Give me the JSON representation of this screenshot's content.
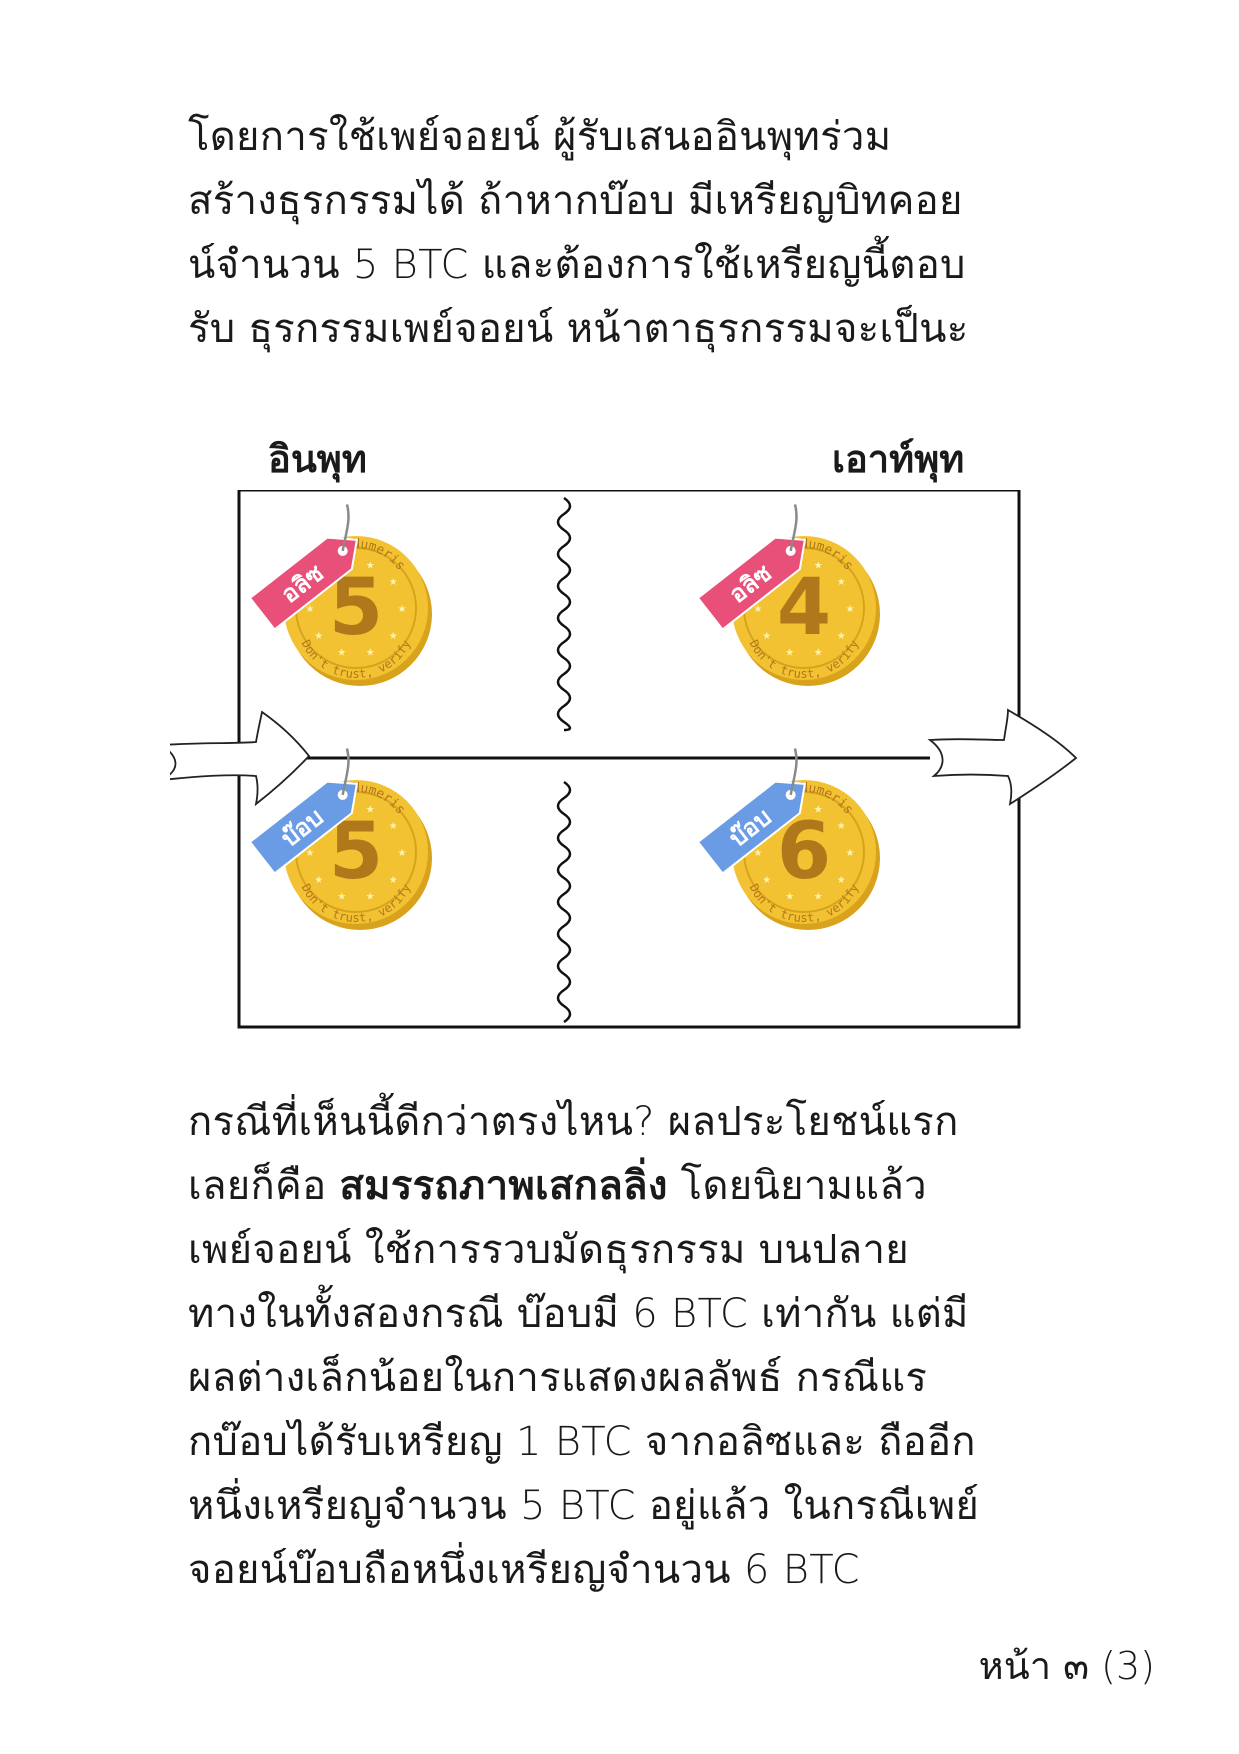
{
  "paragraph1": [
    "โดยการใช้เพย์จอยน์ ผู้รับเสนออินพุทร่วม",
    "สร้างธุรกรรมได้ ถ้าหากบ๊อบ มีเหรียญบิทคอย",
    "น์จำนวน 5 BTC และต้องการใช้เหรียญนี้ตอบ",
    "รับ ธุรกรรมเพย์จอยน์ หน้าตาธุรกรรมจะเป็นะ"
  ],
  "diagram": {
    "input_label": "อินพุท",
    "output_label": "เอาท์พุท",
    "coin_motto_top": "Vires Numeris",
    "coin_motto_bottom": "Don't trust, verify",
    "coins": [
      {
        "side": "input",
        "owner": "อลิซ",
        "amount": "5",
        "tag_color": "#e8507a"
      },
      {
        "side": "output",
        "owner": "อลิซ",
        "amount": "4",
        "tag_color": "#e8507a"
      },
      {
        "side": "input",
        "owner": "บ๊อบ",
        "amount": "5",
        "tag_color": "#6a9ce6"
      },
      {
        "side": "output",
        "owner": "บ๊อบ",
        "amount": "6",
        "tag_color": "#6a9ce6"
      }
    ],
    "colors": {
      "coin_fill": "#f3c232",
      "coin_rim": "#d9a21c",
      "coin_number": "#b0781a"
    }
  },
  "paragraph2": {
    "line1": "กรณีที่เห็นนี้ดีกว่าตรงไหน? ผลประโยชน์แรก",
    "line2_pre": "เลยก็คือ ",
    "line2_bold": "สมรรถภาพเสกลลิ่ง",
    "line2_post": " โดยนิยามแล้ว",
    "lines": [
      "เพย์จอยน์ ใช้การรวบมัดธุรกรรม บนปลาย",
      "ทางในทั้งสองกรณี บ๊อบมี 6 BTC เท่ากัน แต่มี",
      "ผลต่างเล็กน้อยในการแสดงผลลัพธ์ กรณีแร",
      "กบ๊อบได้รับเหรียญ 1 BTC จากอลิซและ ถืออีก",
      "หนึ่งเหรียญจำนวน 5 BTC อยู่แล้ว ในกรณีเพย์",
      "จอยน์บ๊อบถือหนึ่งเหรียญจำนวน 6 BTC"
    ]
  },
  "footer": {
    "page_label": "หน้า ๓ (3)"
  }
}
